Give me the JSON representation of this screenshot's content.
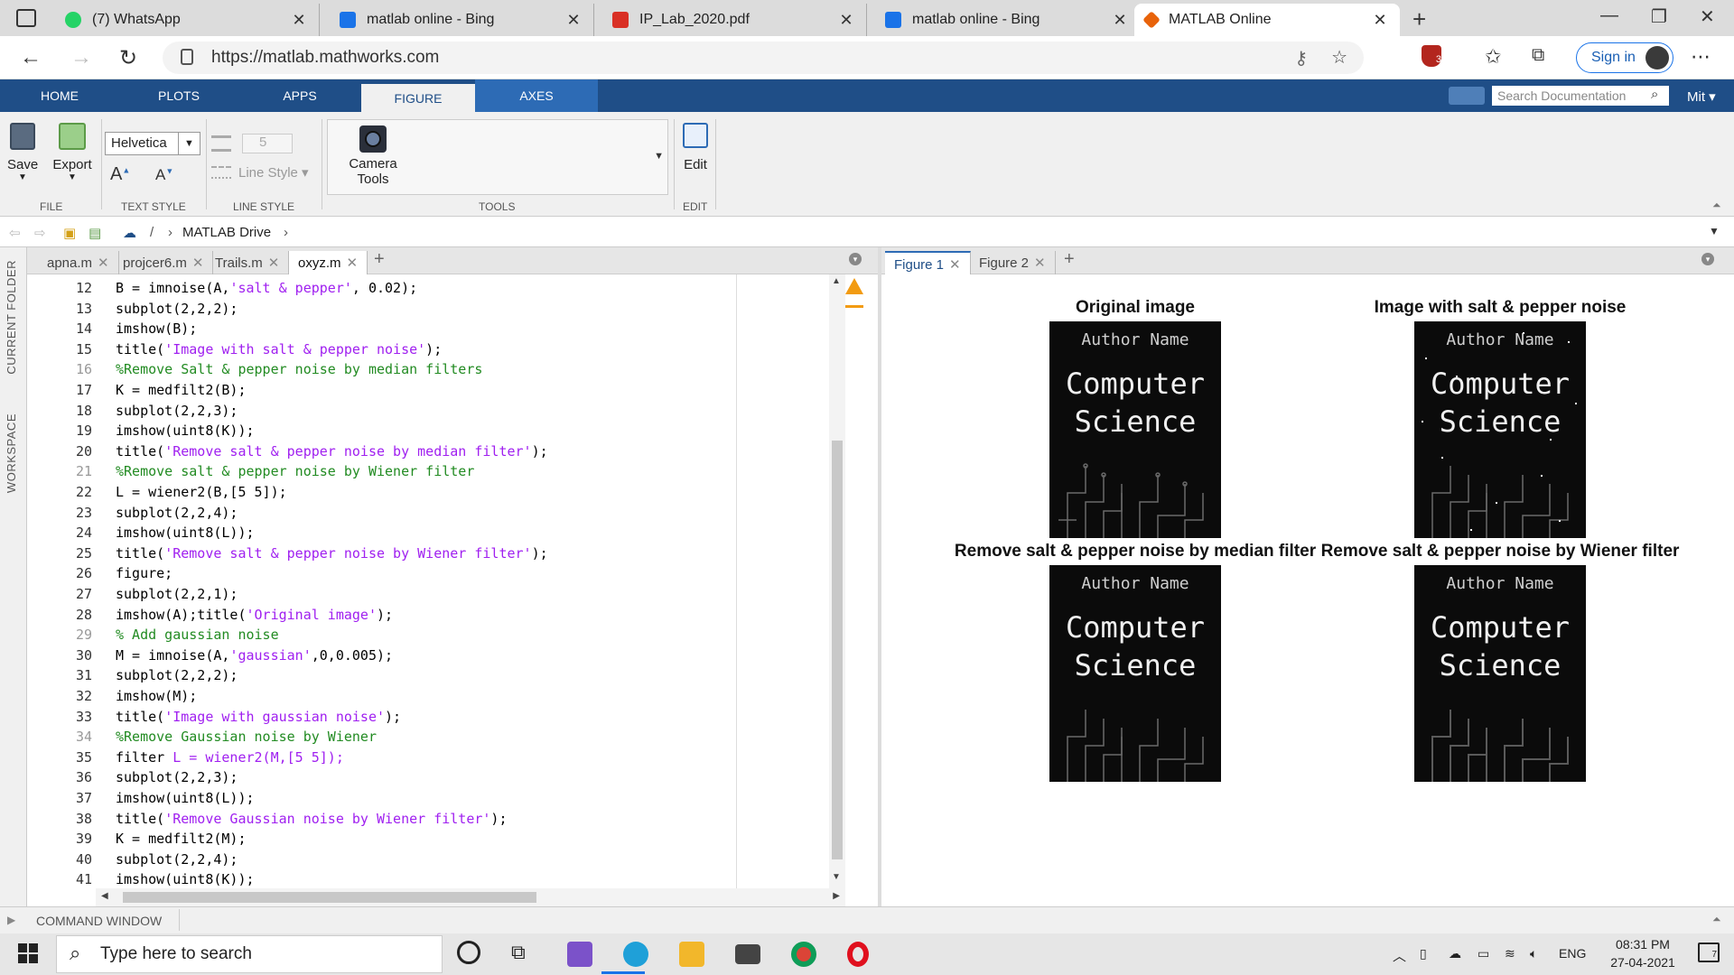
{
  "browser": {
    "tabs": [
      {
        "title": "(7) WhatsApp",
        "favicon_color": "#25d366"
      },
      {
        "title": "matlab online - Bing",
        "favicon_color": "#1a73e8"
      },
      {
        "title": "IP_Lab_2020.pdf",
        "favicon_color": "#d93025"
      },
      {
        "title": "matlab online - Bing",
        "favicon_color": "#1a73e8"
      },
      {
        "title": "MATLAB Online",
        "favicon_color": "#e8630a"
      }
    ],
    "url": "https://matlab.mathworks.com",
    "signin_label": "Sign in",
    "shield_badge": "3"
  },
  "matlab": {
    "tabs": [
      "HOME",
      "PLOTS",
      "APPS",
      "FIGURE",
      "AXES"
    ],
    "active_tab": "FIGURE",
    "search_placeholder": "Search Documentation",
    "user": "Mit",
    "ribbon": {
      "save": "Save",
      "export": "Export",
      "font": "Helvetica",
      "font_size_up": "A",
      "font_size_down": "A",
      "line_width": "5",
      "line_style": "Line Style",
      "camera_tools_1": "Camera",
      "camera_tools_2": "Tools",
      "edit": "Edit",
      "groups": [
        "FILE",
        "TEXT STYLE",
        "LINE STYLE",
        "TOOLS",
        "EDIT"
      ]
    },
    "breadcrumb": {
      "sep": "/",
      "folder": "MATLAB Drive"
    },
    "side_labels": [
      "CURRENT FOLDER",
      "WORKSPACE"
    ],
    "editor_tabs": [
      "apna.m",
      "projcer6.m",
      "Trails.m",
      "oxyz.m"
    ],
    "active_editor_tab": "oxyz.m",
    "code_lines": [
      {
        "n": "12",
        "parts": [
          {
            "t": "B = imnoise(A,",
            "c": ""
          },
          {
            "t": "'salt & pepper'",
            "c": "str"
          },
          {
            "t": ", 0.02);",
            "c": ""
          }
        ]
      },
      {
        "n": "13",
        "parts": [
          {
            "t": "subplot(2,2,2);",
            "c": ""
          }
        ]
      },
      {
        "n": "14",
        "parts": [
          {
            "t": "imshow(B);",
            "c": ""
          }
        ]
      },
      {
        "n": "15",
        "parts": [
          {
            "t": "title(",
            "c": ""
          },
          {
            "t": "'Image with salt & pepper noise'",
            "c": "str"
          },
          {
            "t": ");",
            "c": ""
          }
        ]
      },
      {
        "n": "16",
        "parts": [
          {
            "t": "%Remove Salt & pepper noise by median filters",
            "c": "cmt"
          }
        ]
      },
      {
        "n": "17",
        "parts": [
          {
            "t": "K = medfilt2(B);",
            "c": ""
          }
        ]
      },
      {
        "n": "18",
        "parts": [
          {
            "t": "subplot(2,2,3);",
            "c": ""
          }
        ]
      },
      {
        "n": "19",
        "parts": [
          {
            "t": "imshow(uint8(K));",
            "c": ""
          }
        ]
      },
      {
        "n": "20",
        "parts": [
          {
            "t": "title(",
            "c": ""
          },
          {
            "t": "'Remove salt & pepper noise by median filter'",
            "c": "str"
          },
          {
            "t": ");",
            "c": ""
          }
        ]
      },
      {
        "n": "21",
        "parts": [
          {
            "t": "%Remove salt & pepper noise by Wiener filter",
            "c": "cmt"
          }
        ]
      },
      {
        "n": "22",
        "parts": [
          {
            "t": "L = wiener2(B,[5 5]);",
            "c": ""
          }
        ]
      },
      {
        "n": "23",
        "parts": [
          {
            "t": "subplot(2,2,4);",
            "c": ""
          }
        ]
      },
      {
        "n": "24",
        "parts": [
          {
            "t": "imshow(uint8(L));",
            "c": ""
          }
        ]
      },
      {
        "n": "25",
        "parts": [
          {
            "t": "title(",
            "c": ""
          },
          {
            "t": "'Remove salt & pepper noise by Wiener filter'",
            "c": "str"
          },
          {
            "t": ");",
            "c": ""
          }
        ]
      },
      {
        "n": "26",
        "parts": [
          {
            "t": "figure;",
            "c": ""
          }
        ]
      },
      {
        "n": "27",
        "parts": [
          {
            "t": "subplot(2,2,1);",
            "c": ""
          }
        ]
      },
      {
        "n": "28",
        "parts": [
          {
            "t": "imshow(A);title(",
            "c": ""
          },
          {
            "t": "'Original image'",
            "c": "str"
          },
          {
            "t": ");",
            "c": ""
          }
        ]
      },
      {
        "n": "29",
        "parts": [
          {
            "t": "% Add gaussian noise",
            "c": "cmt"
          }
        ]
      },
      {
        "n": "30",
        "parts": [
          {
            "t": "M = imnoise(A,",
            "c": ""
          },
          {
            "t": "'gaussian'",
            "c": "str"
          },
          {
            "t": ",0,0.005);",
            "c": ""
          }
        ]
      },
      {
        "n": "31",
        "parts": [
          {
            "t": "subplot(2,2,2);",
            "c": ""
          }
        ]
      },
      {
        "n": "32",
        "parts": [
          {
            "t": "imshow(M);",
            "c": ""
          }
        ]
      },
      {
        "n": "33",
        "parts": [
          {
            "t": "title(",
            "c": ""
          },
          {
            "t": "'Image with gaussian noise'",
            "c": "str"
          },
          {
            "t": ");",
            "c": ""
          }
        ]
      },
      {
        "n": "34",
        "parts": [
          {
            "t": "%Remove Gaussian noise by Wiener",
            "c": "cmt"
          }
        ]
      },
      {
        "n": "35",
        "parts": [
          {
            "t": "filter ",
            "c": ""
          },
          {
            "t": "L = wiener2(M,[5 5]);",
            "c": "str"
          }
        ]
      },
      {
        "n": "36",
        "parts": [
          {
            "t": "subplot(2,2,3);",
            "c": ""
          }
        ]
      },
      {
        "n": "37",
        "parts": [
          {
            "t": "imshow(uint8(L));",
            "c": ""
          }
        ]
      },
      {
        "n": "38",
        "parts": [
          {
            "t": "title(",
            "c": ""
          },
          {
            "t": "'Remove Gaussian noise by Wiener filter'",
            "c": "str"
          },
          {
            "t": ");",
            "c": ""
          }
        ]
      },
      {
        "n": "39",
        "parts": [
          {
            "t": "K = medfilt2(M);",
            "c": ""
          }
        ]
      },
      {
        "n": "40",
        "parts": [
          {
            "t": "subplot(2,2,4);",
            "c": ""
          }
        ]
      },
      {
        "n": "41",
        "parts": [
          {
            "t": "imshow(uint8(K));",
            "c": ""
          }
        ]
      }
    ],
    "figure_tabs": [
      "Figure 1",
      "Figure 2"
    ],
    "active_figure_tab": "Figure 1",
    "subplots": [
      {
        "title": "Original image",
        "author": "Author Name",
        "line1": "Computer",
        "line2": "Science"
      },
      {
        "title": "Image with salt & pepper noise",
        "author": "Author Name",
        "line1": "Computer",
        "line2": "Science"
      },
      {
        "title": "Remove salt & pepper noise by median filter",
        "author": "Author Name",
        "line1": "Computer",
        "line2": "Science"
      },
      {
        "title": "Remove salt & pepper noise by Wiener filter",
        "author": "Author Name",
        "line1": "Computer",
        "line2": "Science"
      }
    ],
    "command_window": "COMMAND WINDOW"
  },
  "taskbar": {
    "search_placeholder": "Type here to search",
    "language": "ENG",
    "time": "08:31 PM",
    "date": "27-04-2021",
    "notifications": "7"
  }
}
